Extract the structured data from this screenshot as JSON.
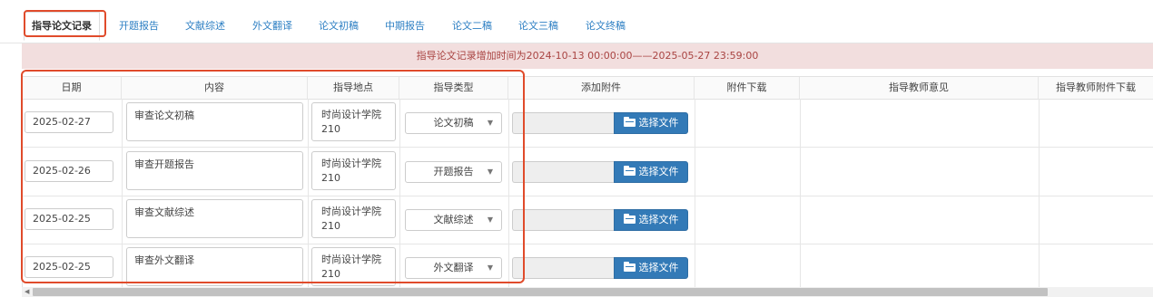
{
  "tabs": [
    {
      "label": "指导论文记录",
      "active": true
    },
    {
      "label": "开题报告"
    },
    {
      "label": "文献综述"
    },
    {
      "label": "外文翻译"
    },
    {
      "label": "论文初稿"
    },
    {
      "label": "中期报告"
    },
    {
      "label": "论文二稿"
    },
    {
      "label": "论文三稿"
    },
    {
      "label": "论文终稿"
    }
  ],
  "banner": {
    "text": "指导论文记录增加时间为2024-10-13 00:00:00——2025-05-27 23:59:00"
  },
  "table": {
    "headers": {
      "date": "日期",
      "content": "内容",
      "place": "指导地点",
      "type": "指导类型",
      "attach": "添加附件",
      "download": "附件下载",
      "opinion": "指导教师意见",
      "teacher_download": "指导教师附件下载"
    },
    "rows": [
      {
        "date": "2025-02-27",
        "content": "审查论文初稿",
        "place": "时尚设计学院210",
        "type": "论文初稿",
        "file_button": "选择文件"
      },
      {
        "date": "2025-02-26",
        "content": "审查开题报告",
        "place": "时尚设计学院210",
        "type": "开题报告",
        "file_button": "选择文件"
      },
      {
        "date": "2025-02-25",
        "content": "审查文献综述",
        "place": "时尚设计学院210",
        "type": "文献综述",
        "file_button": "选择文件"
      },
      {
        "date": "2025-02-25",
        "content": "审查外文翻译",
        "place": "时尚设计学院210",
        "type": "外文翻译",
        "file_button": "选择文件"
      }
    ]
  },
  "colors": {
    "tab_link": "#2d7fc3",
    "banner_bg": "#f2dede",
    "banner_text": "#a94442",
    "button_primary": "#337ab7",
    "annotation_red": "#e04b2b"
  },
  "icons": {
    "file_button_icon": "folder-open-icon",
    "select_caret": "caret-down-icon",
    "scroll_left": "arrow-left-icon"
  }
}
